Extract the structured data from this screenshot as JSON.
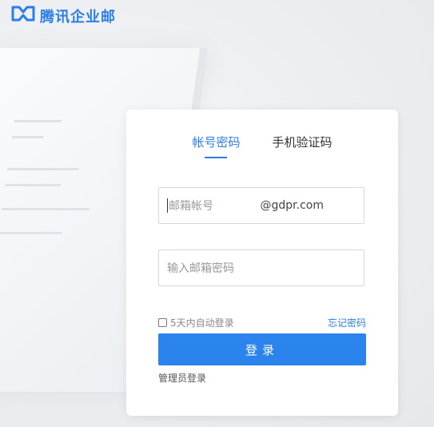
{
  "brand": {
    "name": "腾讯企业邮",
    "color": "#2b7de9"
  },
  "login": {
    "tabs": [
      {
        "label": "帐号密码",
        "active": true
      },
      {
        "label": "手机验证码",
        "active": false
      }
    ],
    "account": {
      "placeholder": "邮箱帐号",
      "domain_suffix": "@gdpr.com"
    },
    "password": {
      "placeholder": "输入邮箱密码"
    },
    "remember_label": "5天内自动登录",
    "forgot_label": "忘记密码",
    "submit_label": "登录",
    "admin_label": "管理员登录",
    "accent": "#2b83ee"
  }
}
